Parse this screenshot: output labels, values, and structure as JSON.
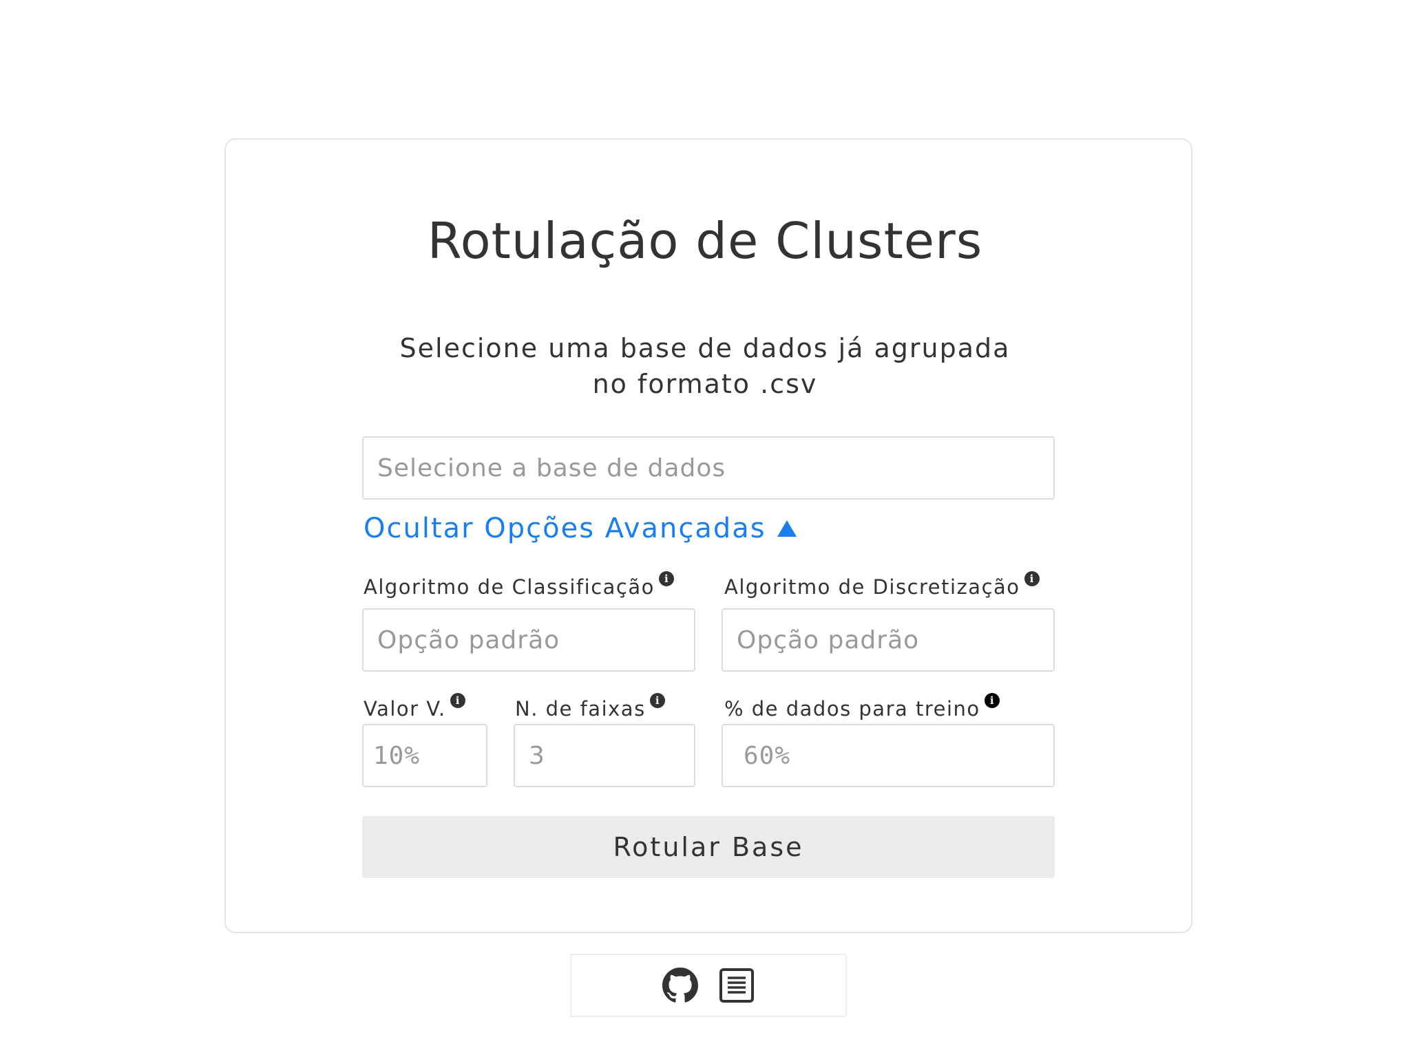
{
  "header": {
    "title": "Rotulação de Clusters",
    "subtitle": "Selecione uma base de dados já agrupada no formato .csv"
  },
  "dataset": {
    "placeholder": "Selecione a base de dados"
  },
  "advanced_toggle": {
    "label": "Ocultar Opções Avançadas",
    "icon": "triangle-up-icon",
    "color": "#1a7ef0"
  },
  "advanced": {
    "classification": {
      "label": "Algoritmo de Classificação",
      "placeholder": "Opção padrão",
      "info_icon": "info-icon"
    },
    "discretization": {
      "label": "Algoritmo de Discretização",
      "placeholder": "Opção padrão",
      "info_icon": "info-icon"
    },
    "valor_v": {
      "label": "Valor V.",
      "placeholder": "10%",
      "info_icon": "info-icon"
    },
    "faixas": {
      "label": "N. de faixas",
      "placeholder": "3",
      "info_icon": "info-icon"
    },
    "treino": {
      "label": "% de dados para treino",
      "placeholder": "60%",
      "info_icon": "info-icon"
    }
  },
  "submit": {
    "label": "Rotular Base"
  },
  "footer": {
    "icons": [
      "github-icon",
      "document-icon"
    ]
  }
}
